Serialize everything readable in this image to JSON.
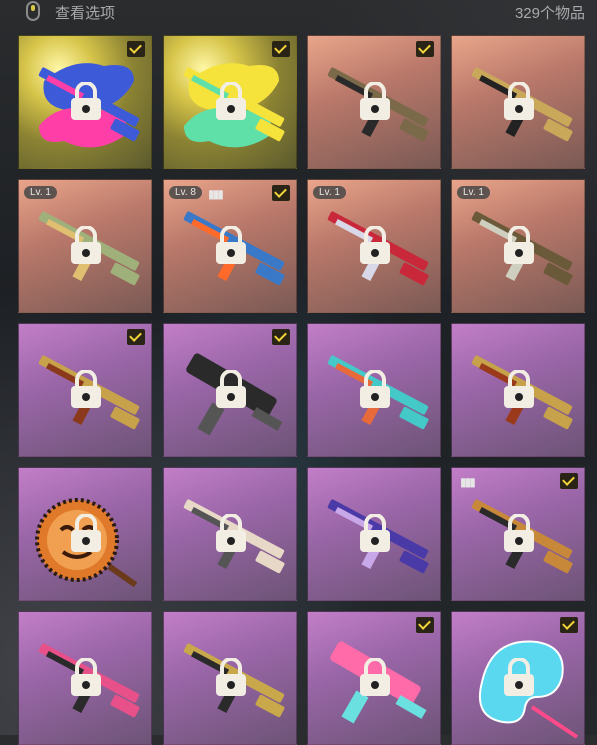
{
  "header": {
    "view_options": "查看选项",
    "item_count": "329个物品"
  },
  "items": [
    {
      "bg": "yellow",
      "checked": true,
      "level": "",
      "bullets": false,
      "art": "splash-rifle",
      "accent": "#3d5bd8",
      "accent2": "#ff3fa7"
    },
    {
      "bg": "yellow",
      "checked": true,
      "level": "",
      "bullets": false,
      "art": "splash-rifle",
      "accent": "#f5e23a",
      "accent2": "#5fe0a8"
    },
    {
      "bg": "orange",
      "checked": true,
      "level": "",
      "bullets": false,
      "art": "rifle",
      "accent": "#7a6a4a",
      "accent2": "#2a2a2a"
    },
    {
      "bg": "orange",
      "checked": false,
      "level": "",
      "bullets": false,
      "art": "rifle",
      "accent": "#c9a85a",
      "accent2": "#222222"
    },
    {
      "bg": "orange",
      "checked": false,
      "level": "Lv. 1",
      "bullets": false,
      "art": "rifle",
      "accent": "#9fb07a",
      "accent2": "#e0c070"
    },
    {
      "bg": "orange",
      "checked": true,
      "level": "Lv. 8",
      "bullets": true,
      "art": "rifle",
      "accent": "#3a78c8",
      "accent2": "#ff6a2a"
    },
    {
      "bg": "orange",
      "checked": false,
      "level": "Lv. 1",
      "bullets": false,
      "art": "rifle",
      "accent": "#c8283a",
      "accent2": "#d8d8e8"
    },
    {
      "bg": "orange",
      "checked": false,
      "level": "Lv. 1",
      "bullets": false,
      "art": "rifle",
      "accent": "#6a5a3a",
      "accent2": "#cfcfbf"
    },
    {
      "bg": "purple",
      "checked": true,
      "level": "",
      "bullets": false,
      "art": "rifle",
      "accent": "#c7a24a",
      "accent2": "#8a3a1a"
    },
    {
      "bg": "purple",
      "checked": true,
      "level": "",
      "bullets": false,
      "art": "smg",
      "accent": "#2a2a2a",
      "accent2": "#555555"
    },
    {
      "bg": "purple",
      "checked": false,
      "level": "",
      "bullets": false,
      "art": "rifle",
      "accent": "#45c8c8",
      "accent2": "#e86a3a"
    },
    {
      "bg": "purple",
      "checked": false,
      "level": "",
      "bullets": false,
      "art": "rifle",
      "accent": "#c7a24a",
      "accent2": "#9a3a1a"
    },
    {
      "bg": "purple",
      "checked": false,
      "level": "",
      "bullets": false,
      "art": "pan",
      "accent": "#e07a2a",
      "accent2": "#222222"
    },
    {
      "bg": "purple",
      "checked": false,
      "level": "",
      "bullets": false,
      "art": "rifle",
      "accent": "#e8d8c8",
      "accent2": "#555555"
    },
    {
      "bg": "purple",
      "checked": false,
      "level": "",
      "bullets": false,
      "art": "rifle",
      "accent": "#4a3aa8",
      "accent2": "#c8a8e8"
    },
    {
      "bg": "purple",
      "checked": true,
      "level": "",
      "bullets": true,
      "art": "rifle",
      "accent": "#c8883a",
      "accent2": "#2a2a2a"
    },
    {
      "bg": "purple",
      "checked": false,
      "level": "",
      "bullets": false,
      "art": "rifle",
      "accent": "#e8508a",
      "accent2": "#2a2a2a"
    },
    {
      "bg": "purple",
      "checked": false,
      "level": "",
      "bullets": false,
      "art": "rifle",
      "accent": "#c8a84a",
      "accent2": "#2a2a2a"
    },
    {
      "bg": "purple",
      "checked": true,
      "level": "",
      "bullets": false,
      "art": "smg",
      "accent": "#ff6aa8",
      "accent2": "#6ae0e0"
    },
    {
      "bg": "purple",
      "checked": true,
      "level": "",
      "bullets": false,
      "art": "palette",
      "accent": "#5ad8f0",
      "accent2": "#ff4a8a"
    }
  ]
}
